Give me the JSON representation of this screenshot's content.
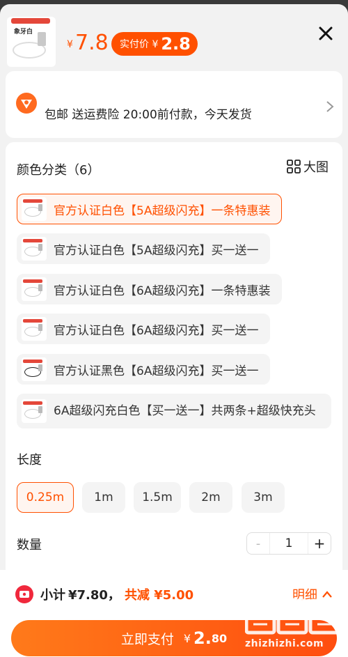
{
  "header": {
    "thumb_brand": "象牙白",
    "price_yen": "¥",
    "price": "7.8",
    "pay_label": "实付价 ¥",
    "pay_amount": "2.8"
  },
  "service": {
    "text": "包邮  送运费险  20:00前付款，今天发货"
  },
  "options": {
    "color_title": "颜色分类（6）",
    "bigview_label": "大图",
    "variants": [
      {
        "label": "官方认证白色【5A超级闪充】一条特惠装",
        "selected": true
      },
      {
        "label": "官方认证白色【5A超级闪充】买一送一",
        "selected": false
      },
      {
        "label": "官方认证白色【6A超级闪充】一条特惠装",
        "selected": false
      },
      {
        "label": "官方认证白色【6A超级闪充】买一送一",
        "selected": false
      },
      {
        "label": "官方认证黑色【6A超级闪充】买一送一",
        "selected": false
      },
      {
        "label": "6A超级闪充白色【买一送一】共两条+超级快充头",
        "selected": false
      }
    ],
    "length_title": "长度",
    "lengths": [
      {
        "label": "0.25m",
        "selected": true
      },
      {
        "label": "1m",
        "selected": false
      },
      {
        "label": "1.5m",
        "selected": false
      },
      {
        "label": "2m",
        "selected": false
      },
      {
        "label": "3m",
        "selected": false
      }
    ],
    "quantity_title": "数量",
    "quantity_minus": "-",
    "quantity_value": "1",
    "quantity_plus": "+"
  },
  "bottom": {
    "subtotal_label": "小计",
    "subtotal_value": "¥7.80，",
    "savings": "共减 ¥5.00",
    "detail_label": "明细",
    "pay_label": "立即支付",
    "pay_yen": "¥",
    "pay_int": "2.",
    "pay_dec": "80"
  },
  "watermark": {
    "site": "zhizhizhi.com"
  },
  "colors": {
    "accent": "#ff5000",
    "selected_bg": "#fff5f0",
    "chip_bg": "#f4f4f4"
  }
}
